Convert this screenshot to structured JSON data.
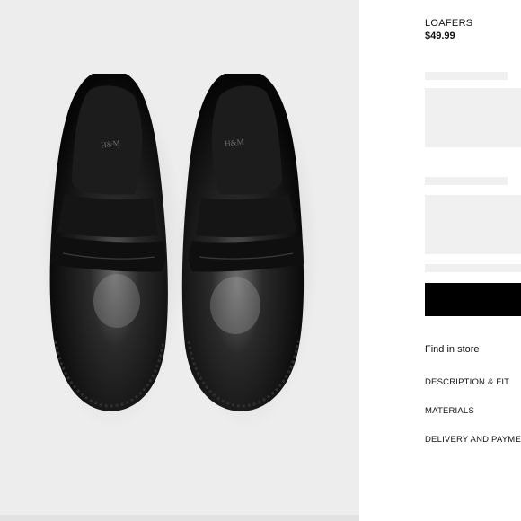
{
  "product": {
    "name": "LOAFERS",
    "price": "$49.99",
    "image_alt": "Black leather penny loafers",
    "insole_logo": "H&M"
  },
  "actions": {
    "find_in_store": "Find in store"
  },
  "accordion": [
    {
      "label": "DESCRIPTION & FIT"
    },
    {
      "label": "MATERIALS"
    },
    {
      "label": "DELIVERY AND PAYMENT"
    }
  ],
  "colors": {
    "background": "#ffffff",
    "image_background": "#ededee",
    "skeleton": "#f0f0f0",
    "button": "#000000",
    "text": "#111111"
  }
}
